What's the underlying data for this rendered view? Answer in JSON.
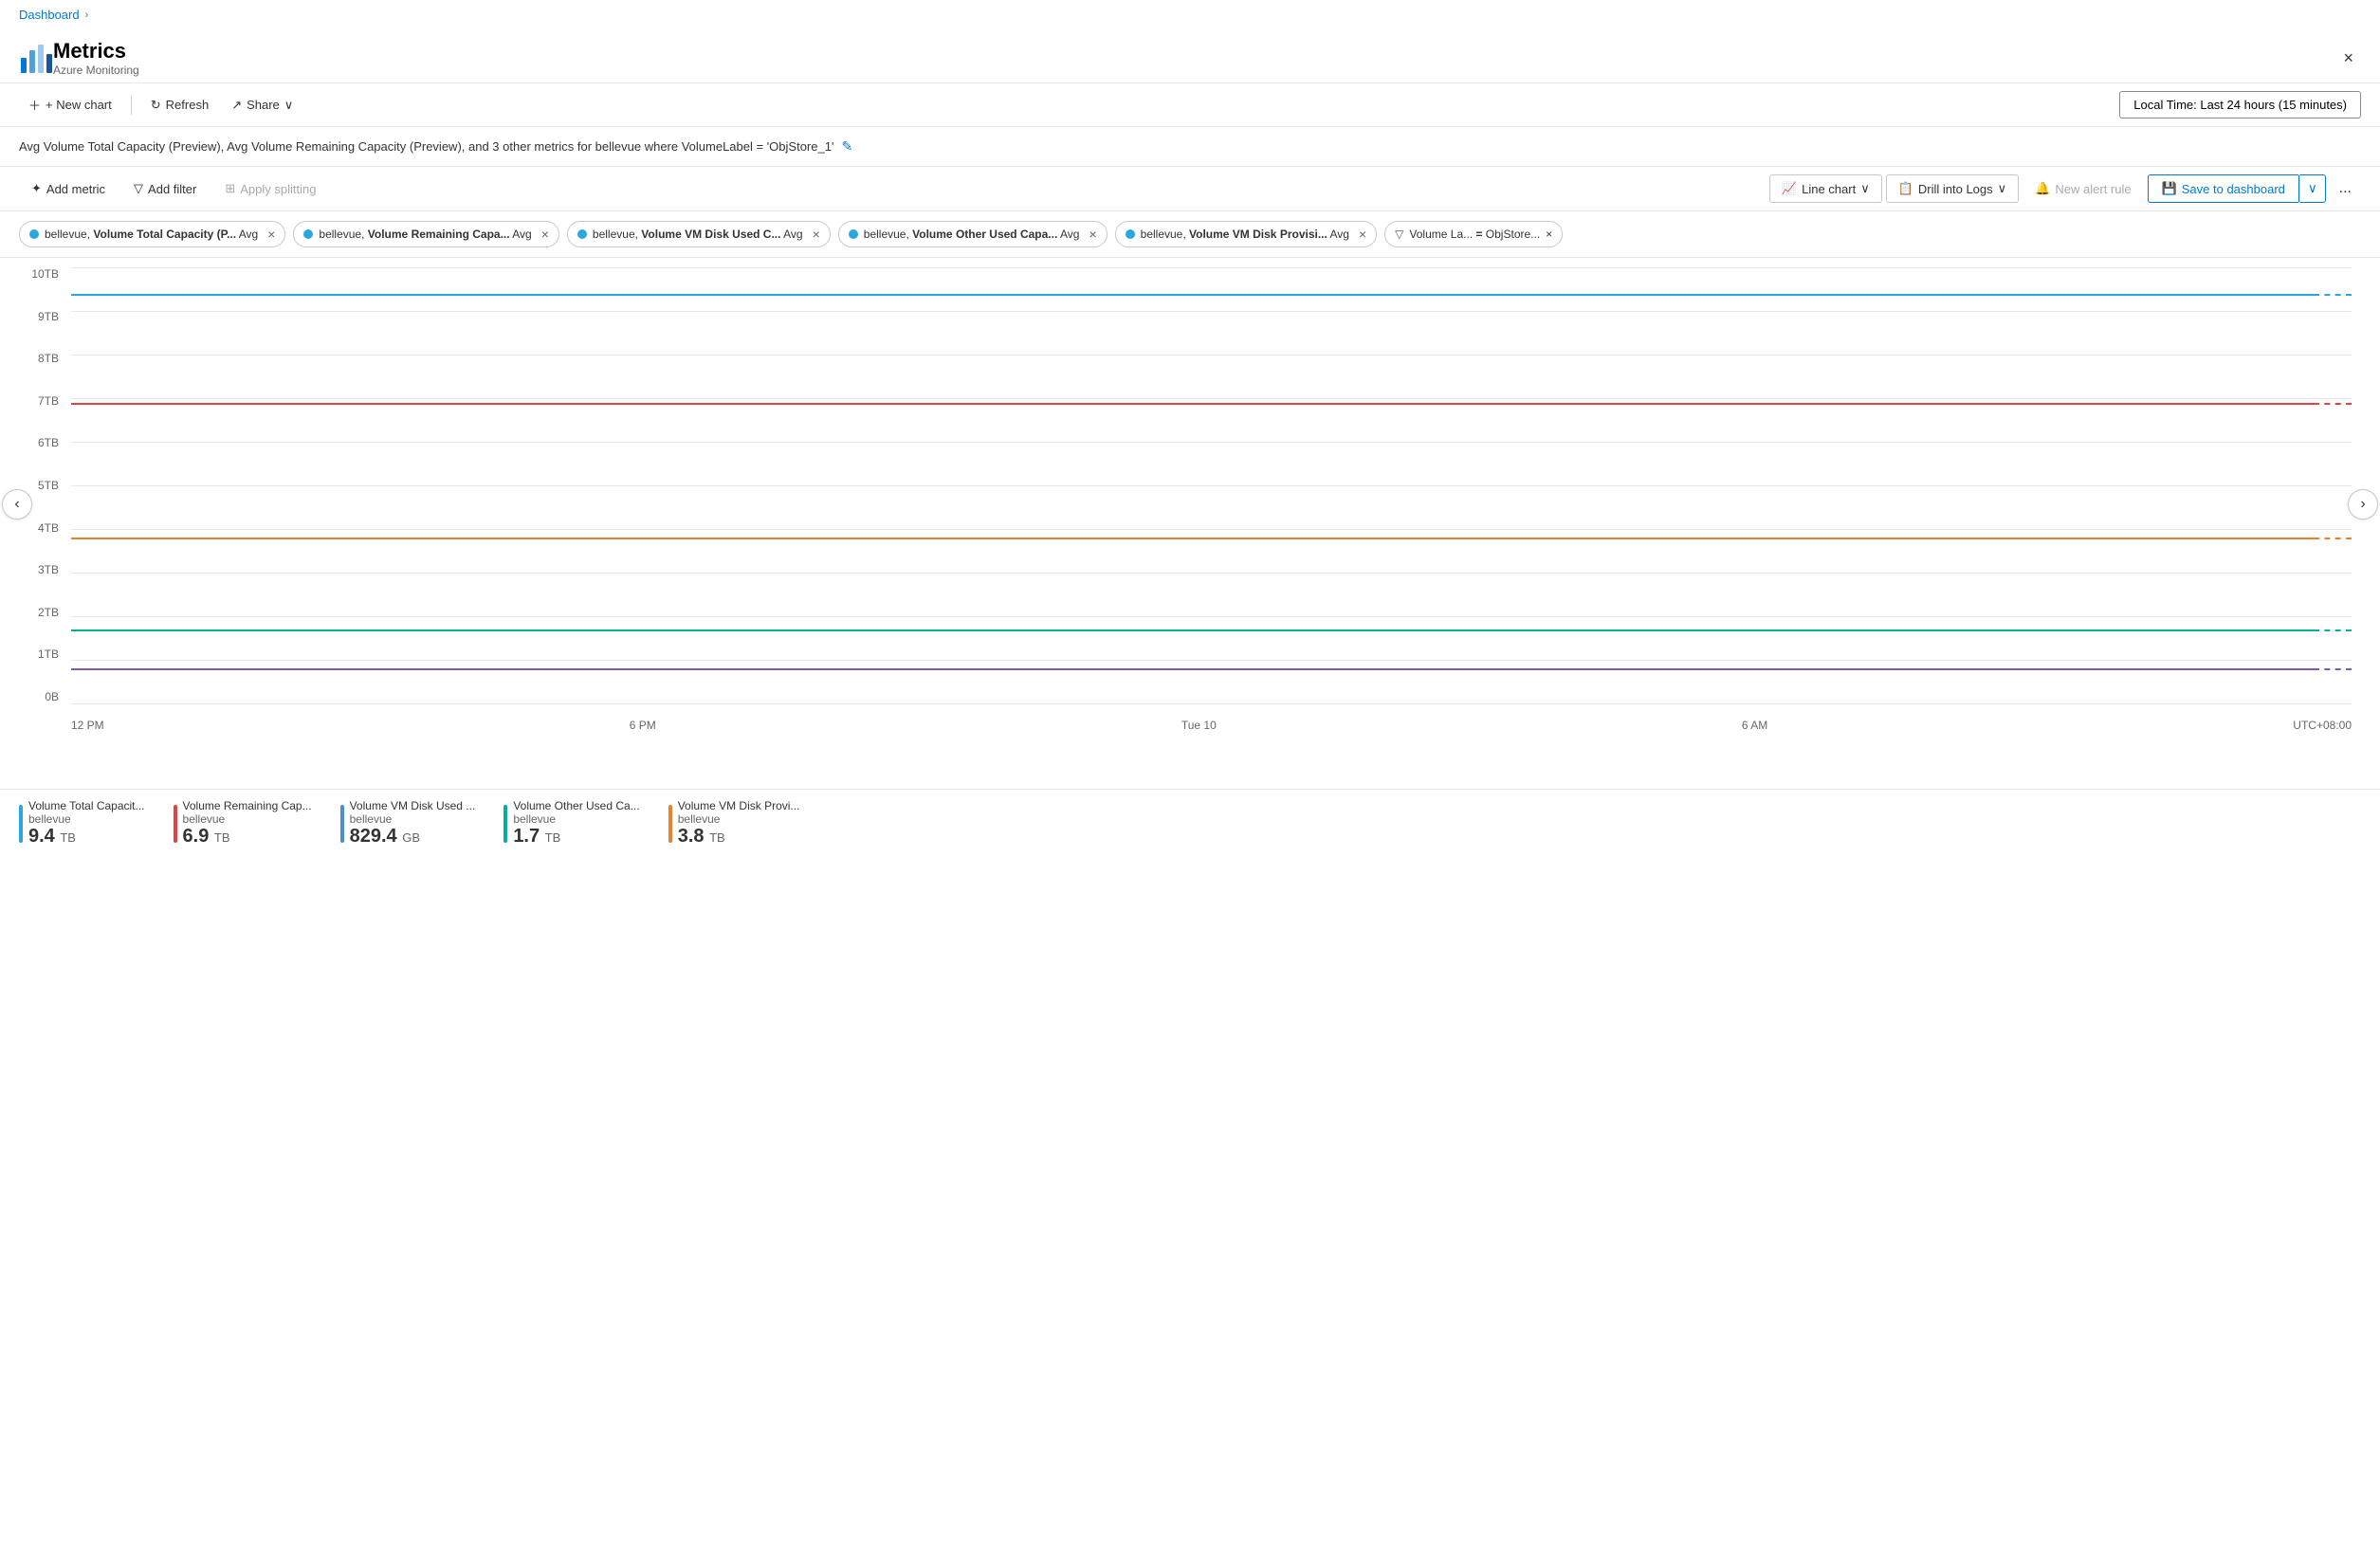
{
  "breadcrumb": {
    "items": [
      "Dashboard"
    ],
    "chevron": "›"
  },
  "header": {
    "title": "Metrics",
    "subtitle": "Azure Monitoring",
    "close_label": "×"
  },
  "top_toolbar": {
    "new_chart": "+ New chart",
    "refresh": "Refresh",
    "share": "Share",
    "time_range": "Local Time: Last 24 hours (15 minutes)"
  },
  "chart_title": "Avg Volume Total Capacity (Preview), Avg Volume Remaining Capacity (Preview), and 3 other metrics for bellevue where VolumeLabel = 'ObjStore_1'",
  "chart_toolbar": {
    "add_metric": "Add metric",
    "add_filter": "Add filter",
    "apply_splitting": "Apply splitting",
    "line_chart": "Line chart",
    "drill_into_logs": "Drill into Logs",
    "new_alert_rule": "New alert rule",
    "save_to_dashboard": "Save to dashboard",
    "more": "..."
  },
  "metric_tags": [
    {
      "id": "tag1",
      "color": "#29a8e0",
      "label": "bellevue, ",
      "bold": "Volume Total Capacity (P...",
      "suffix": " Avg"
    },
    {
      "id": "tag2",
      "color": "#29a8e0",
      "label": "bellevue, ",
      "bold": "Volume Remaining Capa...",
      "suffix": " Avg"
    },
    {
      "id": "tag3",
      "color": "#29a8e0",
      "label": "bellevue, ",
      "bold": "Volume VM Disk Used C...",
      "suffix": " Avg"
    },
    {
      "id": "tag4",
      "color": "#29a8e0",
      "label": "bellevue, ",
      "bold": "Volume Other Used Capa...",
      "suffix": " Avg"
    },
    {
      "id": "tag5",
      "color": "#29a8e0",
      "label": "bellevue, ",
      "bold": "Volume VM Disk Provisi...",
      "suffix": " Avg"
    }
  ],
  "filter_tag": {
    "label": "Volume La...",
    "operator": " = ",
    "value": "ObjStore..."
  },
  "y_axis": {
    "labels": [
      "10TB",
      "9TB",
      "8TB",
      "7TB",
      "6TB",
      "5TB",
      "4TB",
      "3TB",
      "2TB",
      "1TB",
      "0B"
    ]
  },
  "x_axis": {
    "labels": [
      "12 PM",
      "6 PM",
      "Tue 10",
      "6 AM",
      "UTC+08:00"
    ]
  },
  "chart_lines": [
    {
      "id": "line1",
      "color": "#29a8e0",
      "top_pct": 9,
      "dotted_color": "#29a8e0"
    },
    {
      "id": "line2",
      "color": "#e84040",
      "top_pct": 31,
      "dotted_color": "#e84040"
    },
    {
      "id": "line3",
      "color": "#e8822a",
      "top_pct": 62,
      "dotted_color": "#e8822a"
    },
    {
      "id": "line4",
      "color": "#00b29a",
      "top_pct": 77,
      "dotted_color": "#00b29a"
    },
    {
      "id": "line5",
      "color": "#7b5ea7",
      "top_pct": 83,
      "dotted_color": "#7b5ea7"
    }
  ],
  "legend": [
    {
      "id": "l1",
      "color": "#29a8e0",
      "name": "Volume Total Capacit...",
      "sub": "bellevue",
      "value": "9.4",
      "unit": "TB"
    },
    {
      "id": "l2",
      "color": "#e84040",
      "name": "Volume Remaining Cap...",
      "sub": "bellevue",
      "value": "6.9",
      "unit": "TB"
    },
    {
      "id": "l3",
      "color": "#4a8fd4",
      "name": "Volume VM Disk Used ...",
      "sub": "bellevue",
      "value": "829.4",
      "unit": "GB"
    },
    {
      "id": "l4",
      "color": "#00b29a",
      "name": "Volume Other Used Ca...",
      "sub": "bellevue",
      "value": "1.7",
      "unit": "TB"
    },
    {
      "id": "l5",
      "color": "#e8822a",
      "name": "Volume VM Disk Provi...",
      "sub": "bellevue",
      "value": "3.8",
      "unit": "TB"
    }
  ]
}
